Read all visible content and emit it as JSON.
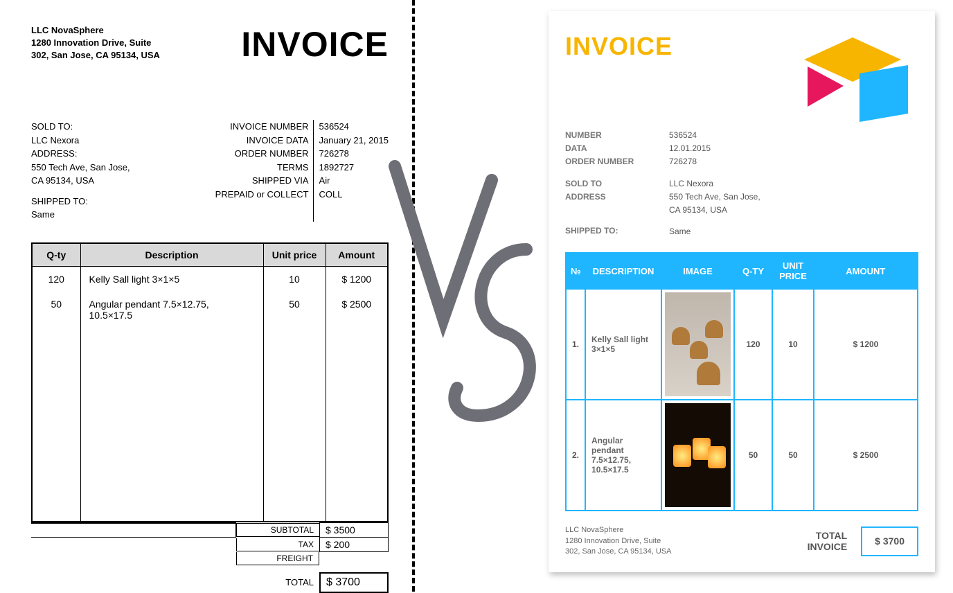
{
  "left": {
    "company": {
      "name": "LLC NovaSphere",
      "addr1": "1280 Innovation Drive, Suite",
      "addr2": "302, San Jose, CA 95134, USA"
    },
    "title": "INVOICE",
    "sold": {
      "label_sold": "SOLD TO:",
      "name": "LLC Nexora",
      "label_addr": "ADDRESS:",
      "addr1": "550 Tech Ave, San Jose,",
      "addr2": "CA 95134, USA",
      "label_ship": "SHIPPED TO:",
      "ship": "Same"
    },
    "meta": {
      "l1": "INVOICE NUMBER",
      "v1": "536524",
      "l2": "INVOICE DATA",
      "v2": "January 21, 2015",
      "l3": "ORDER NUMBER",
      "v3": "726278",
      "l4": "TERMS",
      "v4": "1892727",
      "l5": "SHIPPED VIA",
      "v5": "Air",
      "l6": "PREPAID or COLLECT",
      "v6": "COLL"
    },
    "headers": {
      "qty": "Q-ty",
      "desc": "Description",
      "unit": "Unit price",
      "amt": "Amount"
    },
    "rows": [
      {
        "qty": "120",
        "desc": "Kelly Sall light 3×1×5",
        "unit": "10",
        "amt": "$ 1200"
      },
      {
        "qty": "50",
        "desc": "Angular pendant 7.5×12.75, 10.5×17.5",
        "unit": "50",
        "amt": "$ 2500"
      }
    ],
    "sub_l": "SUBTOTAL",
    "sub_v": "$ 3500",
    "tax_l": "TAX",
    "tax_v": "$ 200",
    "fr_l": "FREIGHT",
    "tot_l": "TOTAL",
    "tot_v": "$ 3700"
  },
  "right": {
    "title": "INVOICE",
    "meta1": {
      "l1": "NUMBER",
      "v1": "536524",
      "l2": "DATA",
      "v2": "12.01.2015",
      "l3": "ORDER NUMBER",
      "v3": "726278"
    },
    "meta2": {
      "l1": "SOLD TO",
      "v1": "LLC Nexora",
      "l2": "ADDRESS",
      "v2": "550 Tech Ave, San Jose, CA 95134, USA"
    },
    "meta3": {
      "l1": "SHIPPED TO:",
      "v1": "Same"
    },
    "headers": {
      "n": "№",
      "desc": "DESCRIPTION",
      "img": "IMAGE",
      "qty": "Q-TY",
      "unit": "UNIT PRICE",
      "amt": "AMOUNT"
    },
    "rows": [
      {
        "n": "1.",
        "desc": "Kelly Sall light 3×1×5",
        "qty": "120",
        "unit": "10",
        "amt": "$ 1200"
      },
      {
        "n": "2.",
        "desc": "Angular pendant 7.5×12.75, 10.5×17.5",
        "qty": "50",
        "unit": "50",
        "amt": "$ 2500"
      }
    ],
    "footer": {
      "name": "LLC NovaSphere",
      "addr1": "1280 Innovation Drive, Suite",
      "addr2": "302, San Jose, CA 95134, USA"
    },
    "tot_l1": "TOTAL",
    "tot_l2": "INVOICE",
    "tot_v": "$ 3700"
  }
}
